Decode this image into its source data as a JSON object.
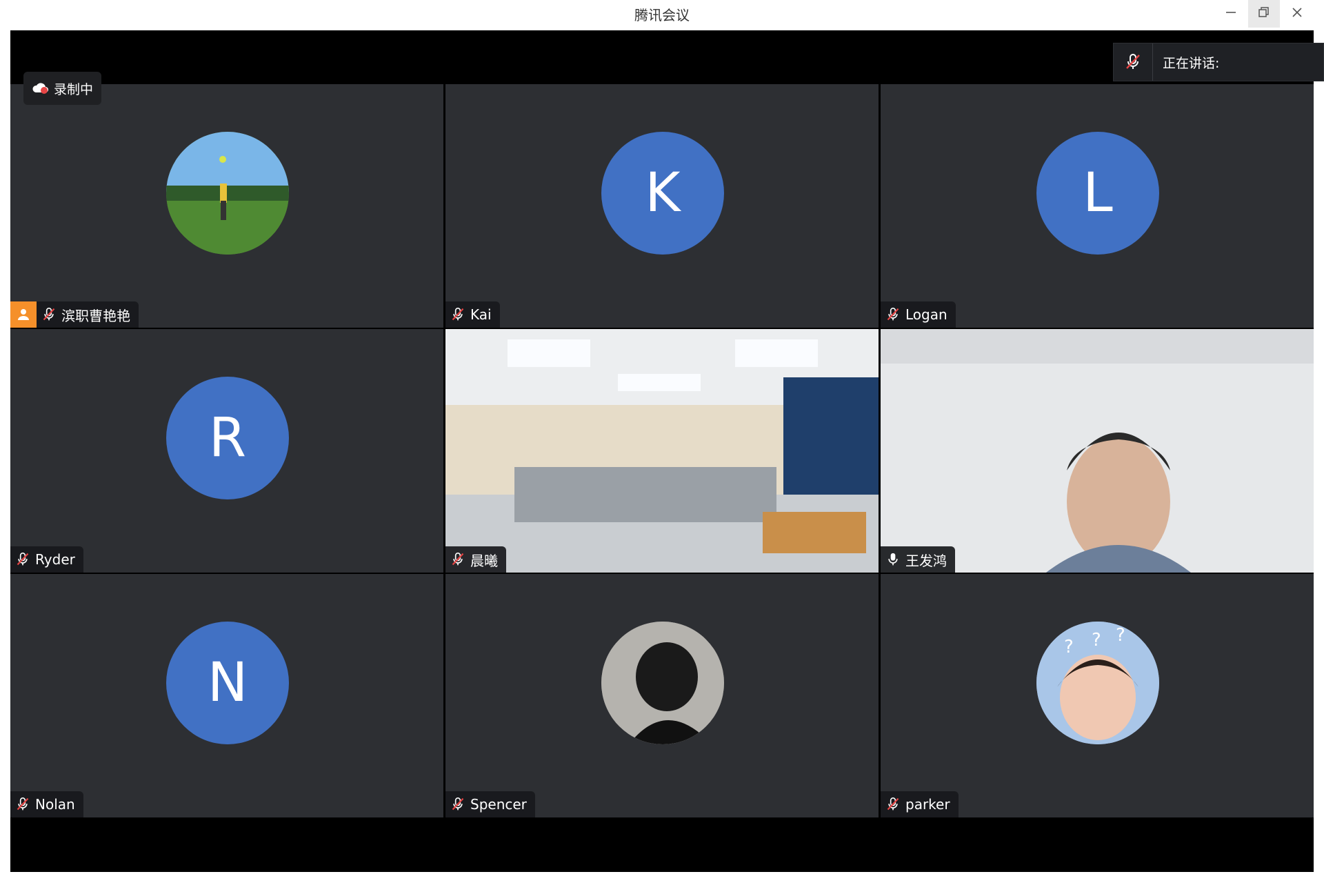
{
  "window": {
    "title": "腾讯会议"
  },
  "recording": {
    "label": "录制中"
  },
  "speaking": {
    "label": "正在讲话:"
  },
  "tiles": [
    {
      "name": "滨职曹艳艳",
      "avatar": "photo",
      "host": true
    },
    {
      "name": "Kai",
      "avatar_letter": "K"
    },
    {
      "name": "Logan",
      "avatar_letter": "L"
    },
    {
      "name": "Ryder",
      "avatar_letter": "R"
    },
    {
      "name": "晨曦",
      "video": "classroom"
    },
    {
      "name": "王发鸿",
      "video": "man",
      "mic": "on"
    },
    {
      "name": "Nolan",
      "avatar_letter": "N"
    },
    {
      "name": "Spencer",
      "avatar": "photo"
    },
    {
      "name": "parker",
      "avatar": "photo"
    }
  ],
  "colors": {
    "tile_bg": "#2d2f33",
    "avatar_blue": "#4171c4",
    "host_orange": "#f5902a",
    "muted_red": "#e64545"
  },
  "icons": [
    "muted-mic-icon",
    "mic-icon",
    "host-icon",
    "recording-icon",
    "minimize-icon",
    "restore-icon",
    "close-icon"
  ]
}
